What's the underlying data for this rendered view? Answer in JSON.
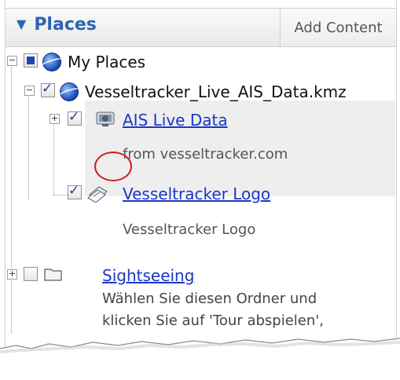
{
  "header": {
    "title": "Places",
    "add_button": "Add Content"
  },
  "tree": {
    "my_places": "My Places",
    "kmz": "Vesseltracker_Live_AIS_Data.kmz",
    "ais": {
      "label": "AIS Live Data",
      "desc": "from vesseltracker.com"
    },
    "logo": {
      "label": "Vesseltracker Logo",
      "desc": "Vesseltracker Logo"
    },
    "sightseeing": {
      "label": "Sightseeing",
      "desc_line1": "Wählen Sie diesen Ordner und",
      "desc_line2": "klicken Sie auf 'Tour abspielen',"
    }
  },
  "colors": {
    "title": "#2a66b3",
    "link": "#1a36c9",
    "selection": "#eeeeee",
    "highlight_ring": "#d31b1b"
  }
}
